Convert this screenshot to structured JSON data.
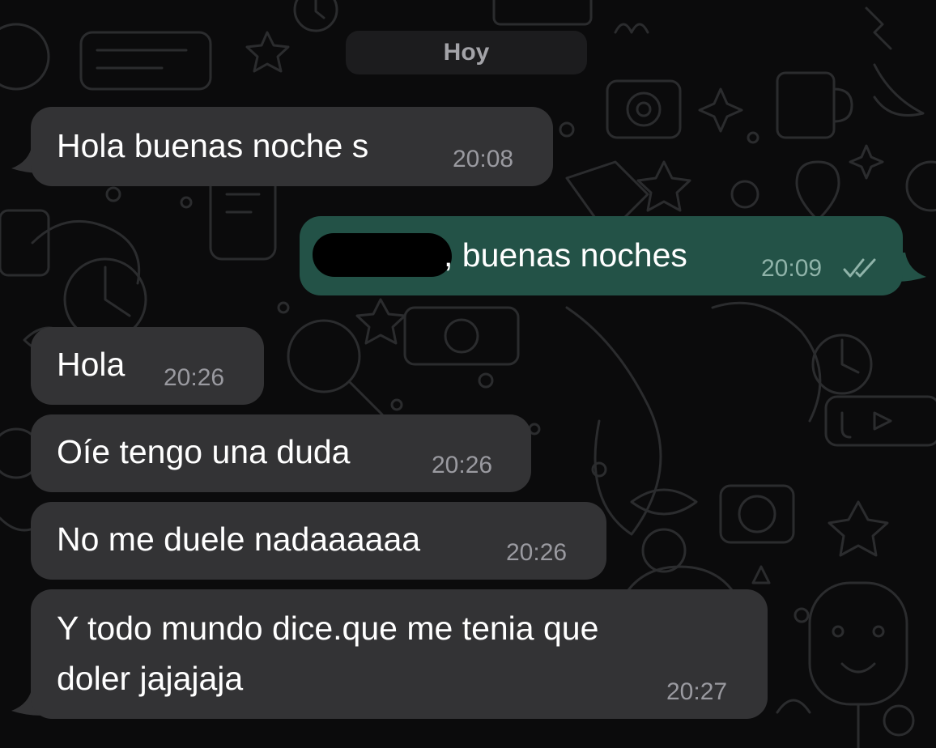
{
  "chat": {
    "date_label": "Hoy",
    "messages": [
      {
        "text": "Hola buenas noche s",
        "time": "20:08"
      },
      {
        "text": ", buenas noches",
        "time": "20:09"
      },
      {
        "text": "Hola",
        "time": "20:26"
      },
      {
        "text": "Oíe tengo una duda",
        "time": "20:26"
      },
      {
        "text": "No me duele nadaaaaaa",
        "time": "20:26"
      },
      {
        "text_lines": [
          "Y todo mundo dice.que me tenia que",
          "doler jajajaja"
        ],
        "time": "20:27"
      }
    ]
  },
  "colors": {
    "background": "#0b0b0c",
    "incoming_bubble": "#333335",
    "outgoing_bubble": "#235247",
    "date_pill": "#1c1c1e",
    "timestamp": "#9a9aa0"
  },
  "icons": [
    "double-check-icon"
  ]
}
